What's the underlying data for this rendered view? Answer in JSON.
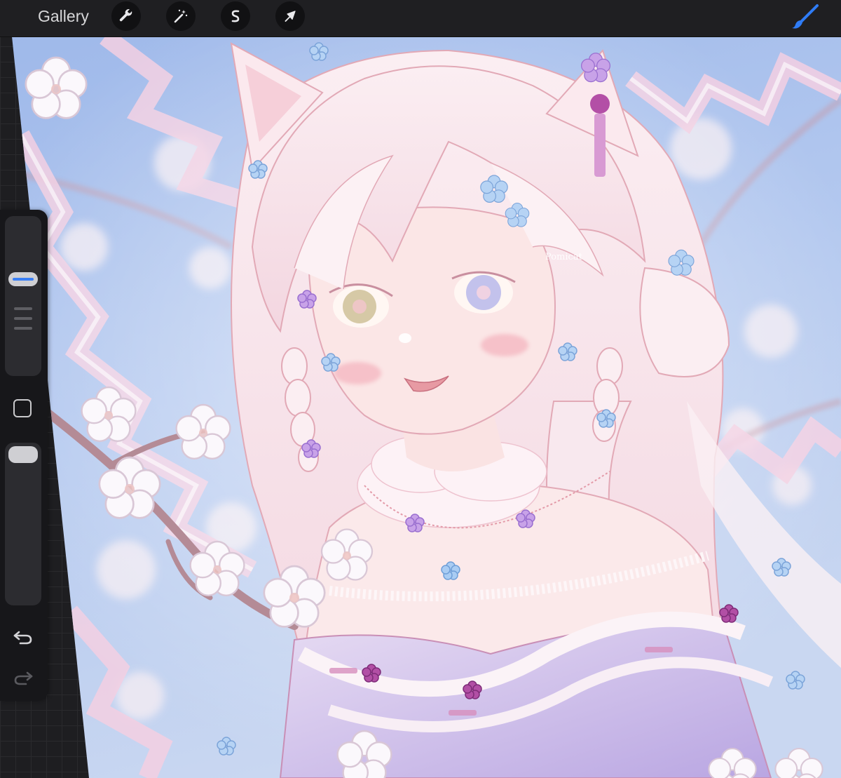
{
  "toolbar": {
    "gallery_label": "Gallery",
    "tools": [
      {
        "name": "actions",
        "icon": "wrench-icon"
      },
      {
        "name": "adjustments",
        "icon": "magic-wand-icon"
      },
      {
        "name": "selection",
        "icon": "selection-s-icon"
      },
      {
        "name": "transform",
        "icon": "arrow-cursor-icon"
      }
    ],
    "active_tool": {
      "name": "brush",
      "icon": "paintbrush-icon",
      "color": "#2f7cf6"
    }
  },
  "sidebar": {
    "brush_size_level": 0.25,
    "opacity_level": 1.0,
    "modify_button_icon": "square-icon",
    "undo_icon": "undo-arrow-icon",
    "redo_icon": "redo-arrow-icon",
    "accent": "#3a7ff6"
  },
  "artwork": {
    "signature": "Pomicat",
    "palette": {
      "sky": "#a9c0ea",
      "hair": "#f6dfe6",
      "blossom": "#fbf7fb",
      "ribbon": "#f3cfe2",
      "kimono": "#c7b7e6",
      "flower_blue": "#9ec3ef",
      "flower_purple": "#b58be0",
      "flower_magenta": "#b24fa5"
    }
  }
}
